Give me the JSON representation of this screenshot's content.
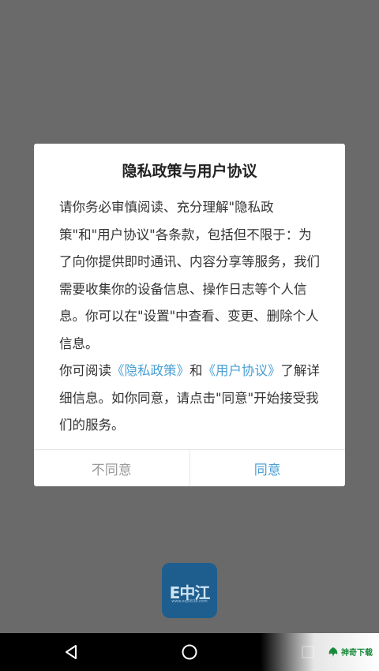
{
  "dialog": {
    "title": "隐私政策与用户协议",
    "para1": "请你务必审慎阅读、充分理解\"隐私政策\"和\"用户协议\"各条款，包括但不限于：为了向你提供即时通讯、内容分享等服务，我们需要收集你的设备信息、操作日志等个人信息。你可以在\"设置\"中查看、变更、删除个人信息。",
    "para2_prefix": "你可阅读",
    "privacy_link": "《隐私政策》",
    "para2_and": "和",
    "terms_link": "《用户协议》",
    "para2_suffix": "了解详细信息。如你同意，请点击\"同意\"开始接受我们的服务。",
    "disagree_label": "不同意",
    "agree_label": "同意"
  },
  "app_icon": {
    "logo_text": "E中江",
    "url_text": "www.ezj0838.com"
  },
  "watermark": {
    "text": "神奇下载"
  },
  "colors": {
    "overlay": "#6a6a6a",
    "link": "#4aa0d5",
    "disabled_text": "#9a9a9a",
    "icon_bg": "#1e5e8e"
  }
}
